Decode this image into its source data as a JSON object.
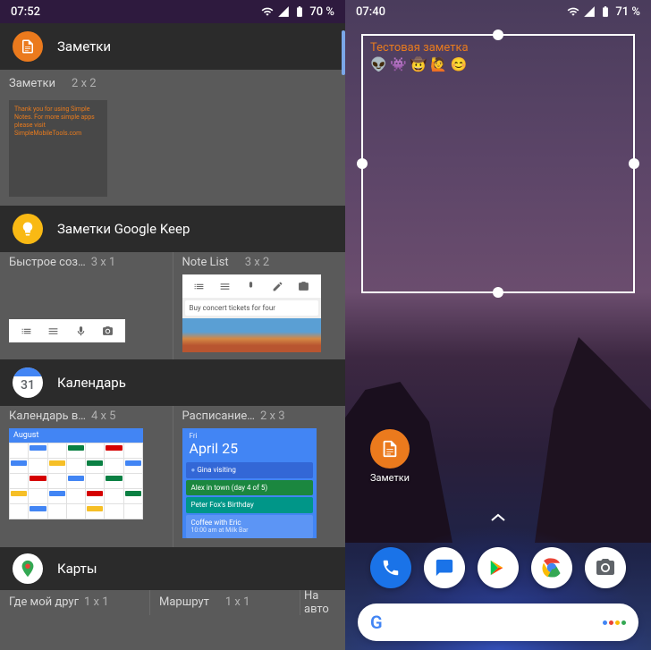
{
  "left": {
    "status": {
      "time": "07:52",
      "battery": "70 %"
    },
    "sections": [
      {
        "title": "Заметки",
        "widgets": [
          {
            "name": "Заметки",
            "size": "2 x 2",
            "preview_text": "Thank you for using Simple Notes.\nFor more simple apps please visit\nSimpleMobileTools.com"
          }
        ]
      },
      {
        "title": "Заметки Google Keep",
        "widgets": [
          {
            "name": "Быстрое соз…",
            "size": "3 x 1"
          },
          {
            "name": "Note List",
            "size": "3 x 2",
            "note_text": "Buy concert tickets for four"
          }
        ]
      },
      {
        "title": "Календарь",
        "calendar_date": "31",
        "widgets": [
          {
            "name": "Календарь в…",
            "size": "4 x 5",
            "month": "August"
          },
          {
            "name": "Расписание…",
            "size": "2 x 3",
            "agenda_day": "Fri",
            "agenda_date": "April 25",
            "events": [
              {
                "text": "Gina visiting"
              },
              {
                "text": "Alex in town (day 4 of 5)"
              },
              {
                "text": "Peter Fox's Birthday"
              },
              {
                "text": "Coffee with Eric",
                "sub": "10:00 am at Milk Bar"
              }
            ]
          }
        ]
      },
      {
        "title": "Карты",
        "widgets": [
          {
            "name": "Где мой друг",
            "size": "1 x 1"
          },
          {
            "name": "Маршрут",
            "size": "1 x 1"
          },
          {
            "name": "На авто"
          }
        ]
      }
    ]
  },
  "right": {
    "status": {
      "time": "07:40",
      "battery": "71 %"
    },
    "widget": {
      "title": "Тестовая заметка",
      "emojis": "👽 👾 🤠 🙋 😊"
    },
    "app": {
      "label": "Заметки"
    },
    "google_letter": "G"
  }
}
